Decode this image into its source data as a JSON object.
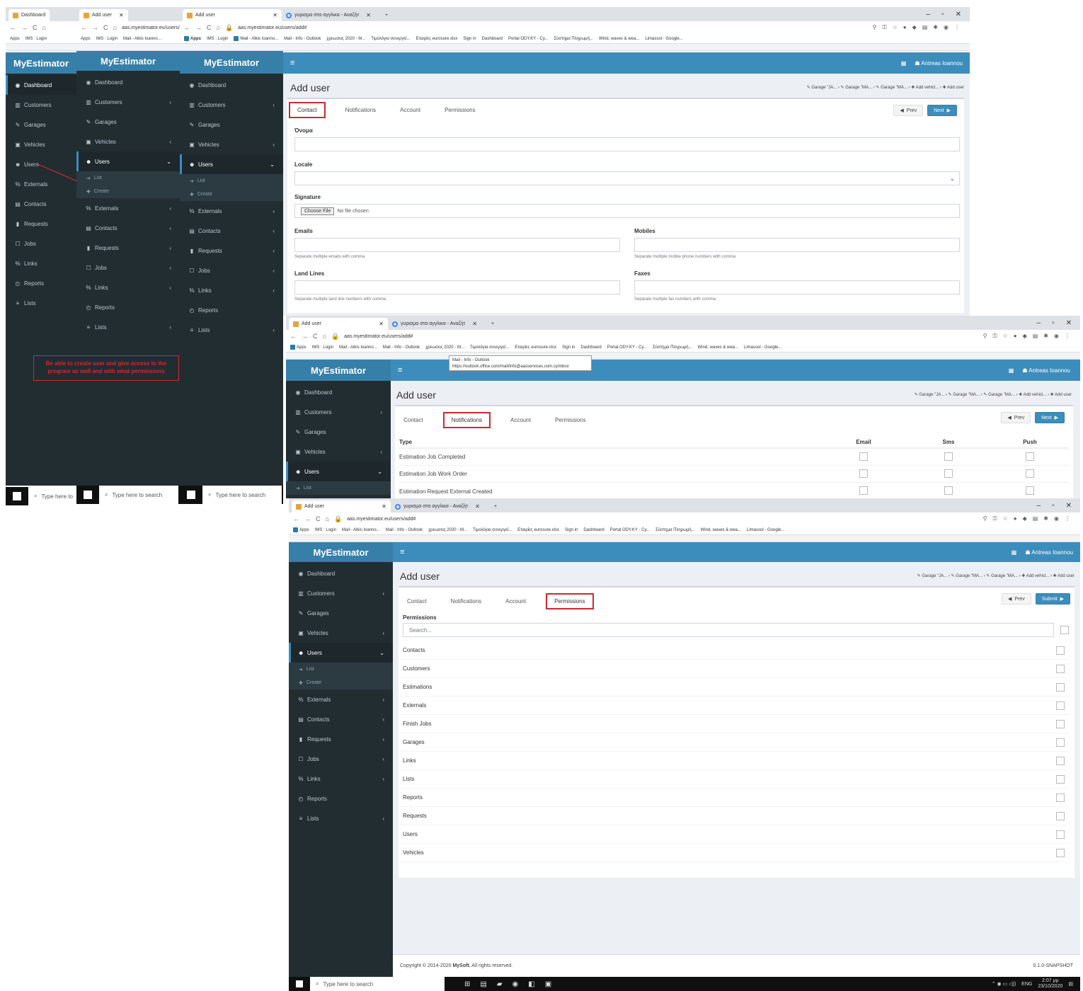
{
  "app": {
    "logo": "MyEstimator",
    "user": "Antreas Ioannou",
    "page_title": "Add user",
    "url": "aas.myestimator.eu/users/add#",
    "tab_title": "Add user",
    "tab_dashboard": "Dashboard",
    "tab_search": "γυρισμα στα αγγλικα - Αναζήτηση",
    "tab_google": "γυρισμα στα αγγλικα - Αναζήτ"
  },
  "bookmarks": [
    "Apps",
    "IMS : Login",
    "Mail - Alkis Ioanno...",
    "Mail - Info - Outlook",
    "χρεωσεις 2020 - M...",
    "Τιμολόγια συνεργεί...",
    "Εταιρίες eurosure.xlsx",
    "Sign in",
    "Dashboard",
    "Portal ODY.KY - Cy...",
    "Σύστημα Πληρωμή...",
    "Wind, waves & wea...",
    "Limassol - Google..."
  ],
  "tooltip": {
    "line1": "Mail - Info - Outlook",
    "line2": "https://outlook.office.com/mail/info@aasservices.com.cy/inbox"
  },
  "sidebar": {
    "dashboard": "Dashboard",
    "customers": "Customers",
    "garages": "Garages",
    "vehicles": "Vehicles",
    "users": "Users",
    "list": "List",
    "create": "Create",
    "externals": "Externals",
    "contacts": "Contacts",
    "requests": "Requests",
    "jobs": "Jobs",
    "links": "Links",
    "reports": "Reports",
    "lists": "Lists"
  },
  "annotation": "Be able to create user and give access to the program as well and with what permissions",
  "breadcrumb": [
    "Garage \"JA...",
    "Garage \"MA...",
    "Garage \"MA...",
    "Add vehicl...",
    "Add user"
  ],
  "tabs": {
    "contact": "Contact",
    "notifications": "Notifications",
    "account": "Account",
    "permissions": "Permissions"
  },
  "buttons": {
    "prev": "Prev",
    "next": "Next",
    "submit": "Submit"
  },
  "contact_form": {
    "name": "Όνομα",
    "locale": "Locale",
    "signature": "Signature",
    "choose_file": "Choose File",
    "no_file": "No file chosen",
    "emails": "Emails",
    "emails_help": "Separate multiple emails with comma",
    "mobiles": "Mobiles",
    "mobiles_help": "Separate multiple mobile phone numbers with comma",
    "land_lines": "Land Lines",
    "land_lines_help": "Separate multiple land line numbers with comma",
    "faxes": "Faxes",
    "faxes_help": "Separate multiple fax numbers with comma"
  },
  "notifications_table": {
    "headers": [
      "Type",
      "Email",
      "Sms",
      "Push"
    ],
    "rows": [
      "Estimation Job Completed",
      "Estimation Job Work Order",
      "Estimation Request External Created"
    ]
  },
  "permissions": {
    "label": "Permissions",
    "search_placeholder": "Search...",
    "items": [
      "Contacts",
      "Customers",
      "Estimations",
      "Externals",
      "Finish Jobs",
      "Garages",
      "Links",
      "Lists",
      "Reports",
      "Requests",
      "Users",
      "Vehicles"
    ]
  },
  "footer": {
    "copyright": "Copyright © 2014-2020",
    "company": "MySoft.",
    "rights": "All rights reserved.",
    "version": "0.1.0-SNAPSHOT"
  },
  "taskbar": {
    "search": "Type here to search",
    "search_short": "Type here to",
    "lang": "ENG",
    "time": "2:07 μμ",
    "date": "23/10/2020"
  }
}
